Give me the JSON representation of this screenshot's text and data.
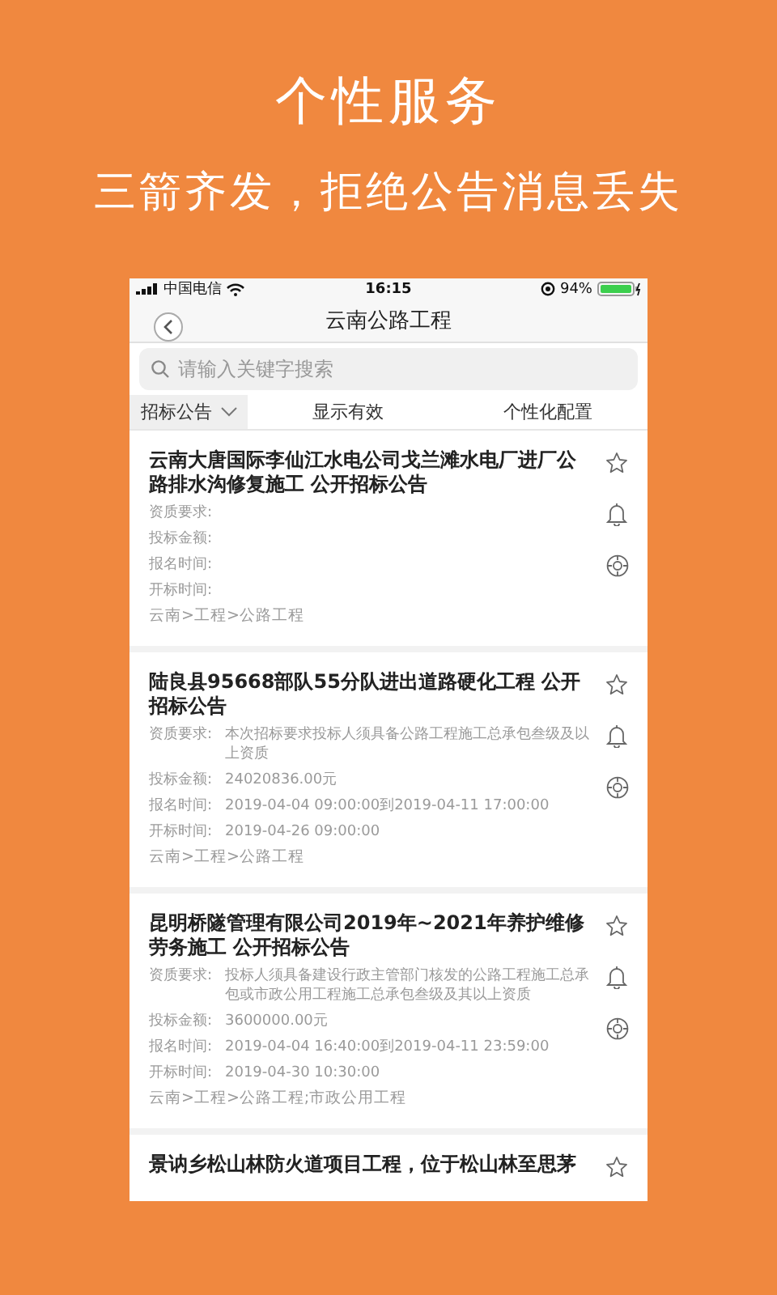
{
  "headline": "个性服务",
  "subtitle": "三箭齐发，拒绝公告消息丢失",
  "status_bar": {
    "carrier": "中国电信",
    "time": "16:15",
    "battery": "94%"
  },
  "nav": {
    "title": "云南公路工程"
  },
  "search": {
    "placeholder": "请输入关键字搜索"
  },
  "filters": [
    {
      "label": "招标公告",
      "kind": "dropdown",
      "selected": true
    },
    {
      "label": "显示有效",
      "kind": "plain",
      "selected": false
    },
    {
      "label": "个性化配置",
      "kind": "plain",
      "selected": false
    }
  ],
  "items": [
    {
      "title": "云南大唐国际李仙江水电公司戈兰滩水电厂进厂公路排水沟修复施工 公开招标公告",
      "fields": [
        {
          "label": "资质要求:"
        },
        {
          "label": "投标金额:"
        },
        {
          "label": "报名时间:"
        },
        {
          "label": "开标时间:"
        }
      ],
      "path": "云南>工程>公路工程"
    },
    {
      "title": "陆良县95668部队55分队进出道路硬化工程 公开招标公告",
      "fields": [
        {
          "label": "资质要求:",
          "value": "本次招标要求投标人须具备公路工程施工总承包叁级及以上资质"
        },
        {
          "label": "投标金额:",
          "value": "24020836.00元"
        },
        {
          "label": "报名时间:",
          "value": "2019-04-04 09:00:00到2019-04-11 17:00:00"
        },
        {
          "label": "开标时间:",
          "value": "2019-04-26 09:00:00"
        }
      ],
      "path": "云南>工程>公路工程"
    },
    {
      "title": "昆明桥隧管理有限公司2019年~2021年养护维修劳务施工 公开招标公告",
      "fields": [
        {
          "label": "资质要求:",
          "value": "投标人须具备建设行政主管部门核发的公路工程施工总承包或市政公用工程施工总承包叁级及其以上资质"
        },
        {
          "label": "投标金额:",
          "value": "3600000.00元"
        },
        {
          "label": "报名时间:",
          "value": "2019-04-04 16:40:00到2019-04-11 23:59:00"
        },
        {
          "label": "开标时间:",
          "value": "2019-04-30 10:30:00"
        }
      ],
      "path": "云南>工程>公路工程;市政公用工程"
    },
    {
      "title": "景讷乡松山林防火道项目工程，位于松山林至思茅"
    }
  ]
}
